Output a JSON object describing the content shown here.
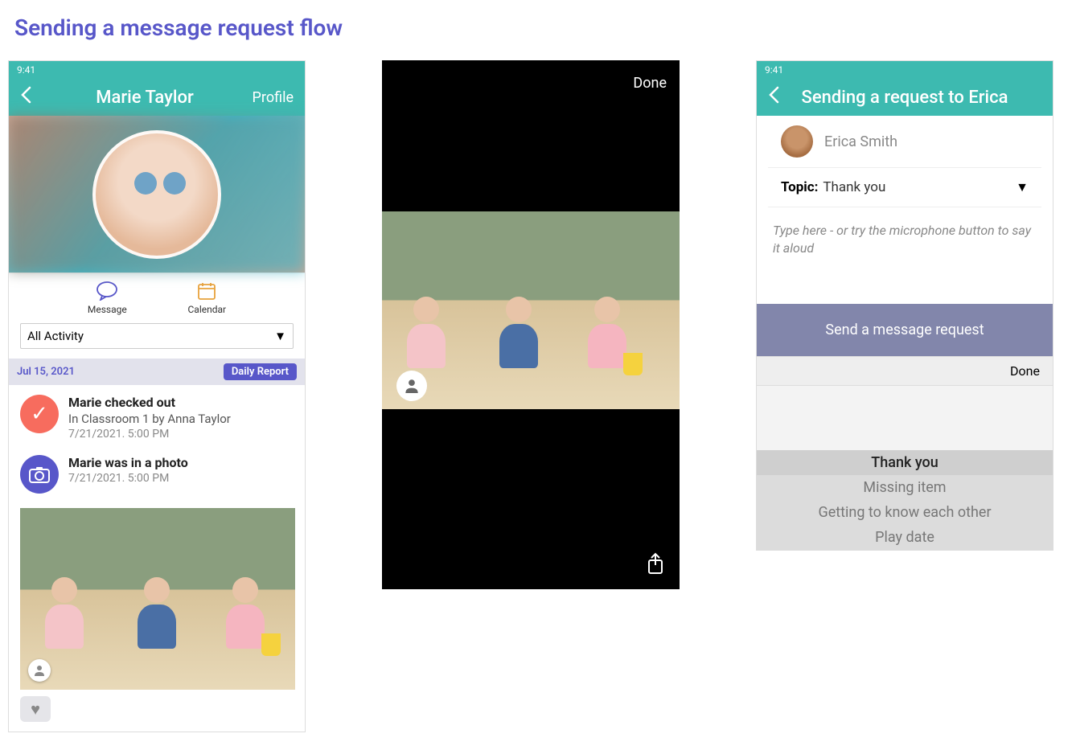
{
  "page": {
    "title": "Sending a message request flow"
  },
  "screen1": {
    "time": "9:41",
    "nav": {
      "title": "Marie Taylor",
      "profile": "Profile"
    },
    "actions": {
      "message": "Message",
      "calendar": "Calendar"
    },
    "filter": "All Activity",
    "date_header": "Jul 15, 2021",
    "daily_report": "Daily Report",
    "feed": {
      "checkout": {
        "title": "Marie checked out",
        "subtitle": "In Classroom 1 by Anna Taylor",
        "ts": "7/21/2021. 5:00 PM"
      },
      "photo": {
        "title": "Marie was in a photo",
        "ts": "7/21/2021. 5:00 PM"
      }
    }
  },
  "screen2": {
    "done": "Done"
  },
  "screen3": {
    "time": "9:41",
    "nav": {
      "title": "Sending a request to Erica"
    },
    "recipient": "Erica Smith",
    "topic_label": "Topic:",
    "topic_value": "Thank you",
    "placeholder": "Type here - or try the microphone button to say it aloud",
    "send": "Send a message request",
    "kb_done": "Done",
    "picker": [
      "Thank you",
      "Missing item",
      "Getting to know each other",
      "Play  date"
    ]
  }
}
